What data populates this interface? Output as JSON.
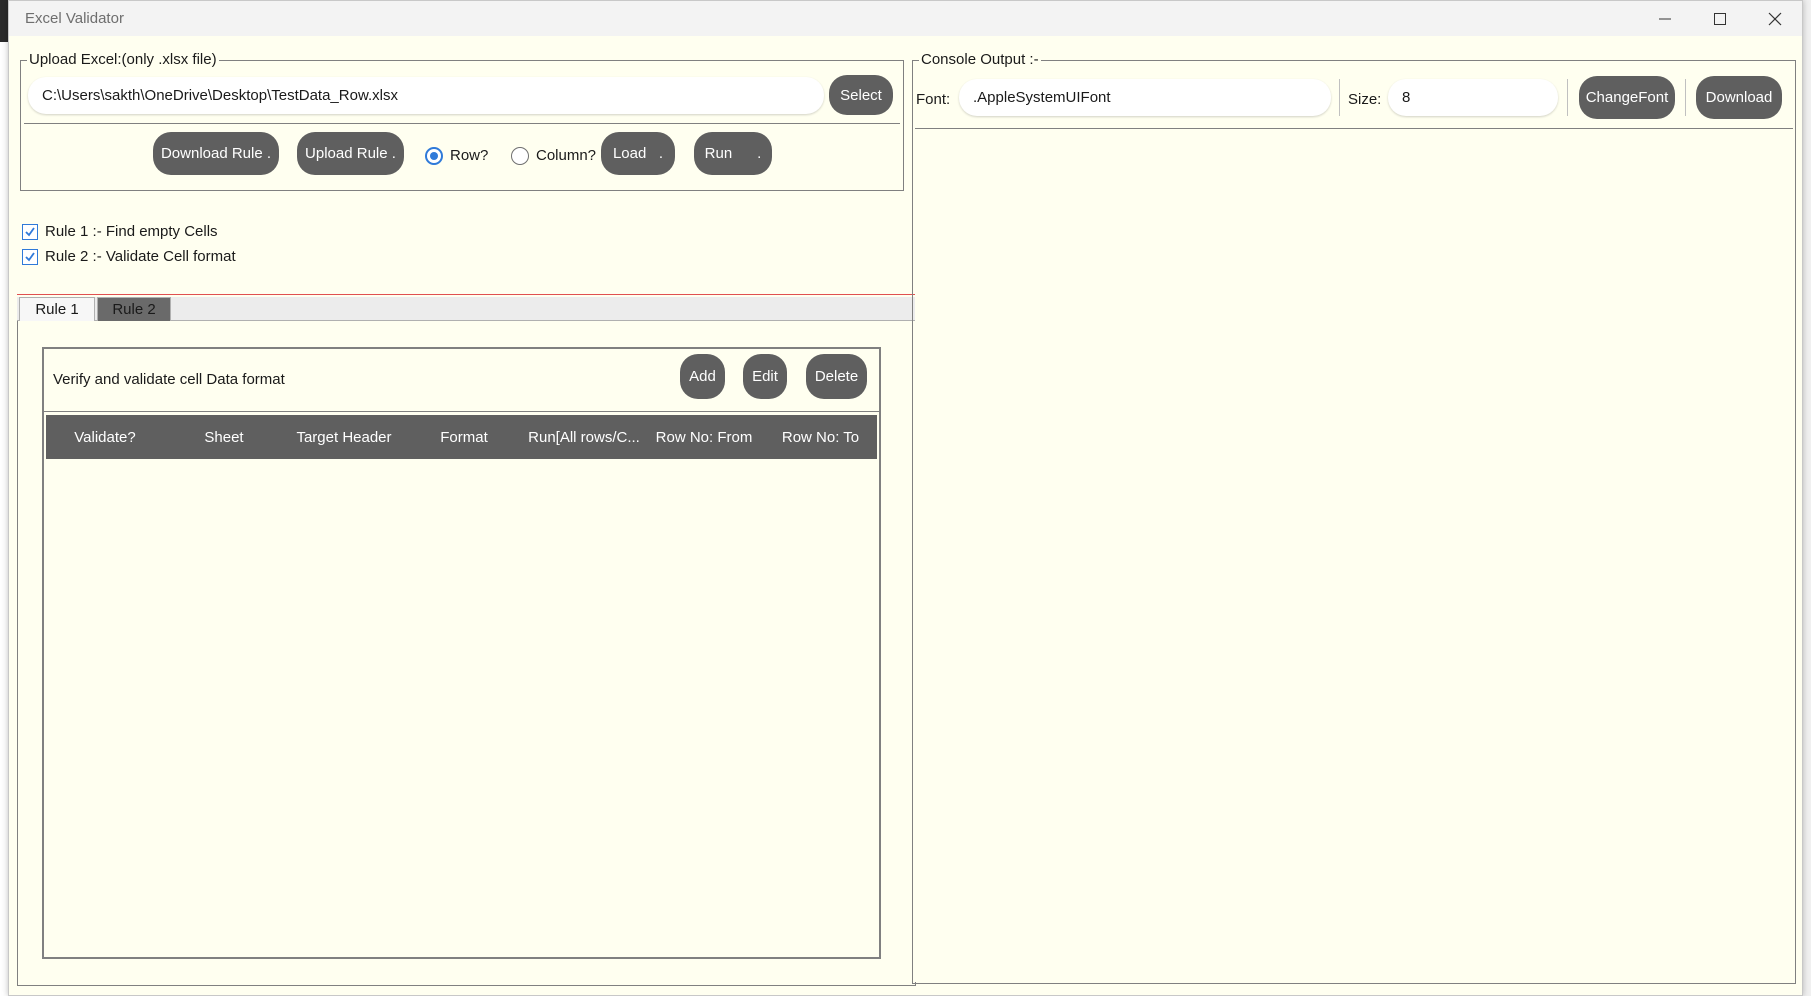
{
  "window": {
    "title": "Excel Validator"
  },
  "upload": {
    "legend": "Upload Excel:(only .xlsx file)",
    "path_value": "C:\\Users\\sakth\\OneDrive\\Desktop\\TestData_Row.xlsx",
    "select_label": "Select",
    "download_rule_label": "Download Rule .",
    "upload_rule_label": "Upload Rule .",
    "row_label": "Row?",
    "column_label": "Column?",
    "load_label": "Load   .",
    "run_label": "Run      .",
    "mode_selected": "Row"
  },
  "rules": [
    {
      "label": "Rule 1 :- Find empty Cells",
      "checked": true
    },
    {
      "label": "Rule 2 :- Validate Cell format",
      "checked": true
    }
  ],
  "tabs": [
    {
      "label": "Rule 1",
      "active": false
    },
    {
      "label": "Rule 2",
      "active": true
    }
  ],
  "rule_panel": {
    "description": "Verify and validate cell Data format",
    "add_label": "Add",
    "edit_label": "Edit",
    "delete_label": "Delete",
    "columns": [
      "Validate?",
      "Sheet",
      "Target Header",
      "Format",
      "Run[All rows/C...",
      "Row No: From",
      "Row No: To"
    ],
    "rows": []
  },
  "console": {
    "legend": "Console Output :-",
    "font_label": "Font:",
    "font_value": ".AppleSystemUIFont",
    "size_label": "Size:",
    "size_value": "8",
    "change_font_label": "ChangeFont",
    "download_label": "Download",
    "output": ""
  },
  "colors": {
    "window_bg": "#fffff0",
    "button_bg": "#5f5f5f",
    "accent": "#2f7ad9",
    "divider_red": "#e05050"
  },
  "icons": {
    "minimize": "minimize-icon",
    "maximize": "maximize-icon",
    "close": "close-icon",
    "check": "check-icon"
  }
}
